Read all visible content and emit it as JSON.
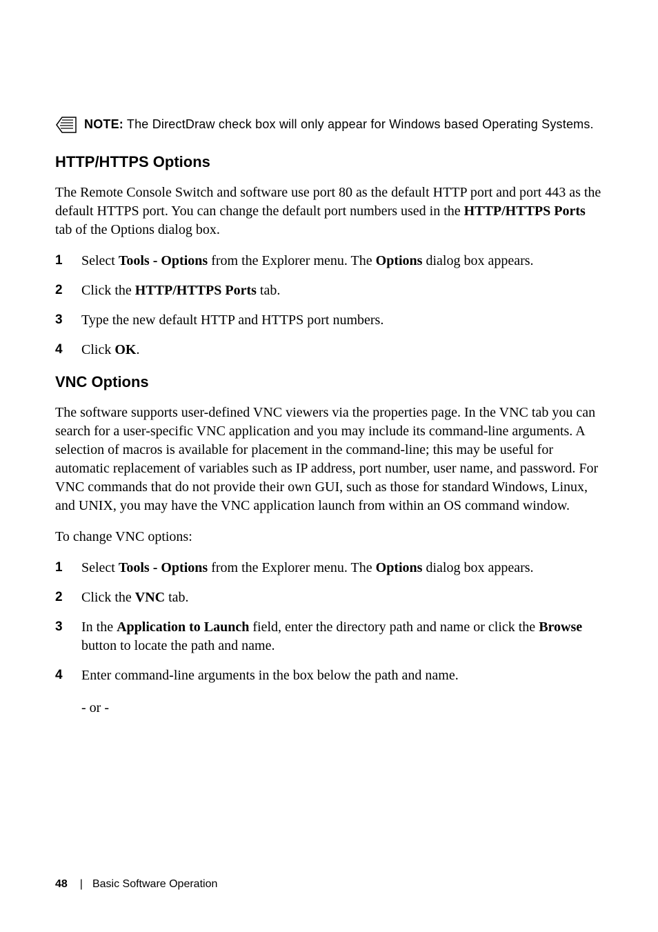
{
  "note": {
    "label": "NOTE:",
    "text": " The DirectDraw check box will only appear for Windows based Operating Systems."
  },
  "section1": {
    "heading": "HTTP/HTTPS Options",
    "para_parts": {
      "p1a": "The Remote Console Switch and software use port 80 as the default HTTP port and port 443 as the default HTTPS port. You can change the default port numbers used in the ",
      "p1b": "HTTP/HTTPS Ports",
      "p1c": " tab of the Options dialog box."
    },
    "steps": {
      "s1": {
        "num": "1",
        "a": "Select ",
        "b": "Tools - Options",
        "c": " from the Explorer menu. The ",
        "d": "Options",
        "e": " dialog box appears."
      },
      "s2": {
        "num": "2",
        "a": "Click the ",
        "b": "HTTP/HTTPS Ports",
        "c": " tab."
      },
      "s3": {
        "num": "3",
        "a": "Type the new default HTTP and HTTPS port numbers."
      },
      "s4": {
        "num": "4",
        "a": "Click ",
        "b": "OK",
        "c": "."
      }
    }
  },
  "section2": {
    "heading": "VNC Options",
    "para": "The software supports user-defined VNC viewers via the properties page. In the VNC tab you can search for a user-specific VNC application and you may include its command-line arguments. A selection of macros is available for placement in the command-line; this may be useful for automatic replacement of variables such as IP address, port number, user name, and password. For VNC commands that do not provide their own GUI, such as those for standard Windows, Linux, and UNIX, you may have the VNC application launch from within an OS command window.",
    "subpara": "To change VNC options:",
    "steps": {
      "s1": {
        "num": "1",
        "a": "Select ",
        "b": "Tools - Options",
        "c": " from the Explorer menu. The ",
        "d": "Options",
        "e": " dialog box appears."
      },
      "s2": {
        "num": "2",
        "a": "Click the ",
        "b": "VNC",
        "c": " tab."
      },
      "s3": {
        "num": "3",
        "a": "In the ",
        "b": "Application to Launch",
        "c": " field, enter the directory path and name or click the ",
        "d": "Browse",
        "e": " button to locate the path and name."
      },
      "s4": {
        "num": "4",
        "a": "Enter command-line arguments in the box below the path and name.",
        "or": "- or -"
      }
    }
  },
  "footer": {
    "page": "48",
    "title": "Basic Software Operation"
  }
}
